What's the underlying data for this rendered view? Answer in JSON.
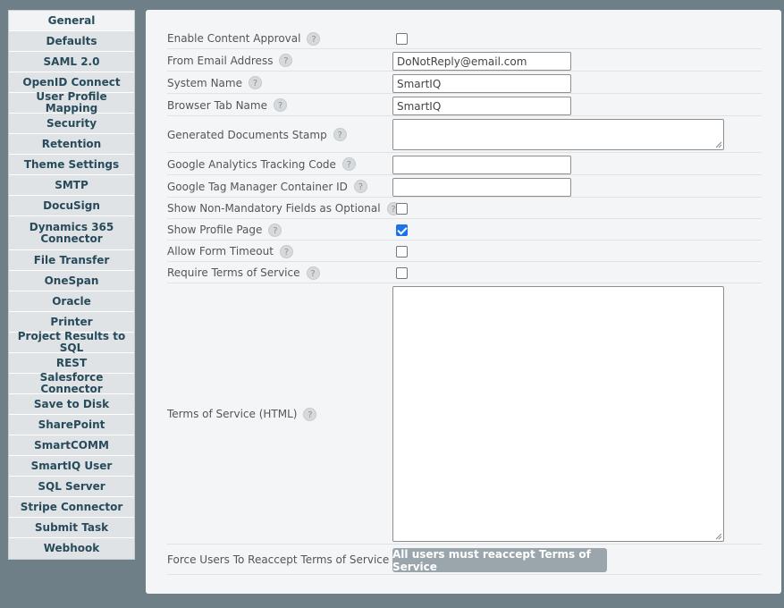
{
  "sidebar": {
    "items": [
      {
        "label": "General",
        "active": true
      },
      {
        "label": "Defaults"
      },
      {
        "label": "SAML 2.0"
      },
      {
        "label": "OpenID Connect"
      },
      {
        "label": "User Profile Mapping"
      },
      {
        "label": "Security"
      },
      {
        "label": "Retention"
      },
      {
        "label": "Theme Settings"
      },
      {
        "label": "SMTP"
      },
      {
        "label": "DocuSign"
      },
      {
        "label": "Dynamics 365\nConnector"
      },
      {
        "label": "File Transfer"
      },
      {
        "label": "OneSpan"
      },
      {
        "label": "Oracle"
      },
      {
        "label": "Printer"
      },
      {
        "label": "Project Results to SQL"
      },
      {
        "label": "REST"
      },
      {
        "label": "Salesforce Connector"
      },
      {
        "label": "Save to Disk"
      },
      {
        "label": "SharePoint"
      },
      {
        "label": "SmartCOMM"
      },
      {
        "label": "SmartIQ User"
      },
      {
        "label": "SQL Server"
      },
      {
        "label": "Stripe Connector"
      },
      {
        "label": "Submit Task"
      },
      {
        "label": "Webhook"
      }
    ]
  },
  "form": {
    "help_glyph": "?",
    "enable_content_approval": {
      "label": "Enable Content Approval",
      "checked": false
    },
    "from_email": {
      "label": "From Email Address",
      "value": "DoNotReply@email.com"
    },
    "system_name": {
      "label": "System Name",
      "value": "SmartIQ"
    },
    "browser_tab_name": {
      "label": "Browser Tab Name",
      "value": "SmartIQ"
    },
    "generated_docs_stamp": {
      "label": "Generated Documents Stamp",
      "value": ""
    },
    "google_analytics": {
      "label": "Google Analytics Tracking Code",
      "value": ""
    },
    "google_tag_manager": {
      "label": "Google Tag Manager Container ID",
      "value": ""
    },
    "show_non_mandatory": {
      "label": "Show Non-Mandatory Fields as Optional",
      "checked": false
    },
    "show_profile_page": {
      "label": "Show Profile Page",
      "checked": true
    },
    "allow_form_timeout": {
      "label": "Allow Form Timeout",
      "checked": false
    },
    "require_tos": {
      "label": "Require Terms of Service",
      "checked": false
    },
    "tos_html": {
      "label": "Terms of Service (HTML)",
      "value": ""
    },
    "force_reaccept": {
      "label": "Force Users To Reaccept Terms of Service",
      "button_label": "All users must reaccept Terms of Service"
    }
  },
  "colors": {
    "background": "#6f7f88",
    "sidebar_item": "#dfe3e6",
    "sidebar_text": "#284b5c",
    "panel": "#f4f5f7",
    "checkbox_checked": "#1a73e8",
    "button": "#9aa5ac"
  }
}
